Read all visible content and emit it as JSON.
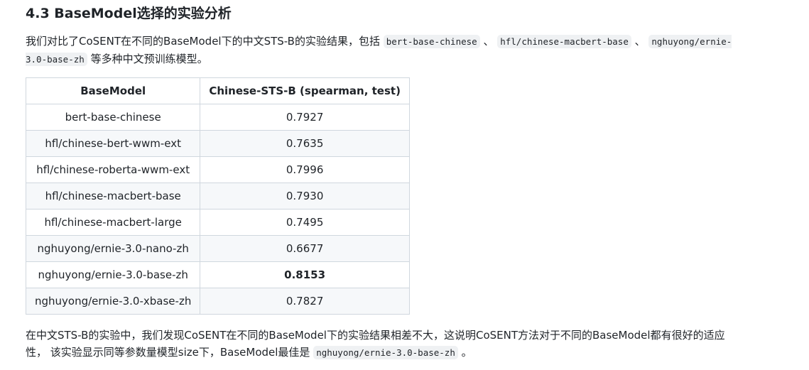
{
  "heading": "4.3 BaseModel选择的实验分析",
  "intro": {
    "text_before": "我们对比了CoSENT在不同的BaseModel下的中文STS-B的实验结果，包括 ",
    "code1": "bert-base-chinese",
    "sep1": " 、 ",
    "code2": "hfl/chinese-macbert-base",
    "sep2": " 、 ",
    "code3": "nghuyong/ernie-3.0-base-zh",
    "text_after": " 等多种中文预训练模型。"
  },
  "table": {
    "headers": [
      "BaseModel",
      "Chinese-STS-B (spearman, test)"
    ],
    "rows": [
      {
        "model": "bert-base-chinese",
        "score": "0.7927",
        "bold": false
      },
      {
        "model": "hfl/chinese-bert-wwm-ext",
        "score": "0.7635",
        "bold": false
      },
      {
        "model": "hfl/chinese-roberta-wwm-ext",
        "score": "0.7996",
        "bold": false
      },
      {
        "model": "hfl/chinese-macbert-base",
        "score": "0.7930",
        "bold": false
      },
      {
        "model": "hfl/chinese-macbert-large",
        "score": "0.7495",
        "bold": false
      },
      {
        "model": "nghuyong/ernie-3.0-nano-zh",
        "score": "0.6677",
        "bold": false
      },
      {
        "model": "nghuyong/ernie-3.0-base-zh",
        "score": "0.8153",
        "bold": true
      },
      {
        "model": "nghuyong/ernie-3.0-xbase-zh",
        "score": "0.7827",
        "bold": false
      }
    ]
  },
  "conclusion": {
    "text_before": "在中文STS-B的实验中，我们发现CoSENT在不同的BaseModel下的实验结果相差不大，这说明CoSENT方法对于不同的BaseModel都有很好的适应性， 该实验显示同等参数量模型size下，BaseModel最佳是 ",
    "code": "nghuyong/ernie-3.0-base-zh",
    "text_after": " 。"
  }
}
